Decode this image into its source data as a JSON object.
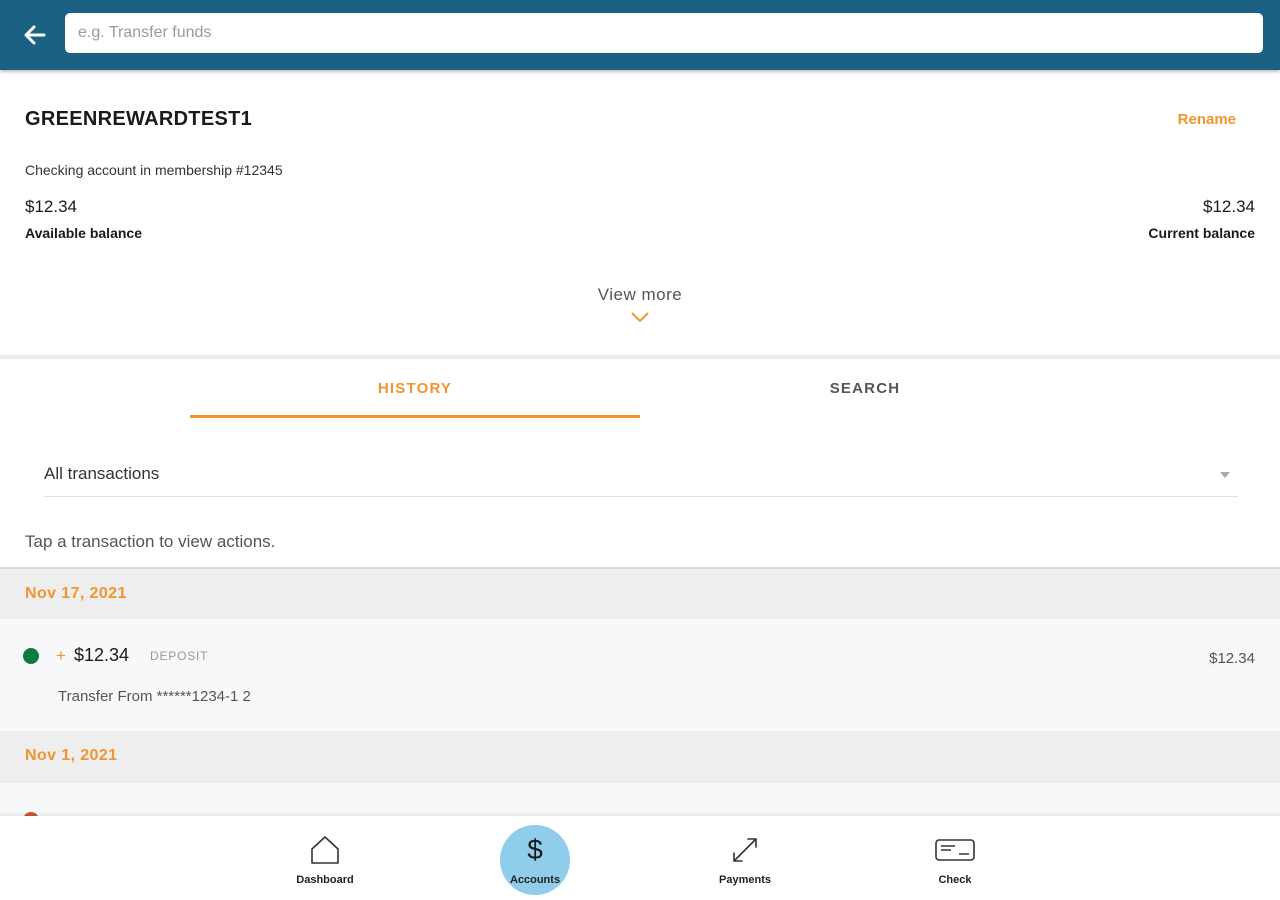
{
  "search": {
    "placeholder": "e.g. Transfer funds"
  },
  "account": {
    "name": "GREENREWARDTEST1",
    "rename_label": "Rename",
    "subtitle": "Checking account in membership #12345",
    "available_amount": "$12.34",
    "available_label": "Available balance",
    "current_amount": "$12.34",
    "current_label": "Current balance",
    "view_more_label": "View more"
  },
  "tabs": [
    {
      "label": "HISTORY",
      "active": true
    },
    {
      "label": "SEARCH",
      "active": false
    }
  ],
  "filter": {
    "selected": "All transactions"
  },
  "hint": "Tap a transaction to view actions.",
  "groups": [
    {
      "date": "Nov 17, 2021",
      "transactions": [
        {
          "sign": "+",
          "amount": "$12.34",
          "type": "DEPOSIT",
          "balance": "$12.34",
          "description": "Transfer From ******1234-1 2",
          "status_color": "#0b7a43"
        }
      ]
    },
    {
      "date": "Nov 1, 2021",
      "transactions": [
        {
          "status_color": "#d6532a"
        }
      ]
    }
  ],
  "bottom_nav": [
    {
      "label": "Dashboard",
      "icon": "home-icon",
      "active": false
    },
    {
      "label": "Accounts",
      "icon": "dollar-icon",
      "active": true
    },
    {
      "label": "Payments",
      "icon": "transfer-arrows-icon",
      "active": false
    },
    {
      "label": "Check",
      "icon": "check-icon",
      "active": false
    }
  ],
  "colors": {
    "header": "#1b6184",
    "accent": "#f0952f",
    "active_nav": "#8fcdeb"
  }
}
